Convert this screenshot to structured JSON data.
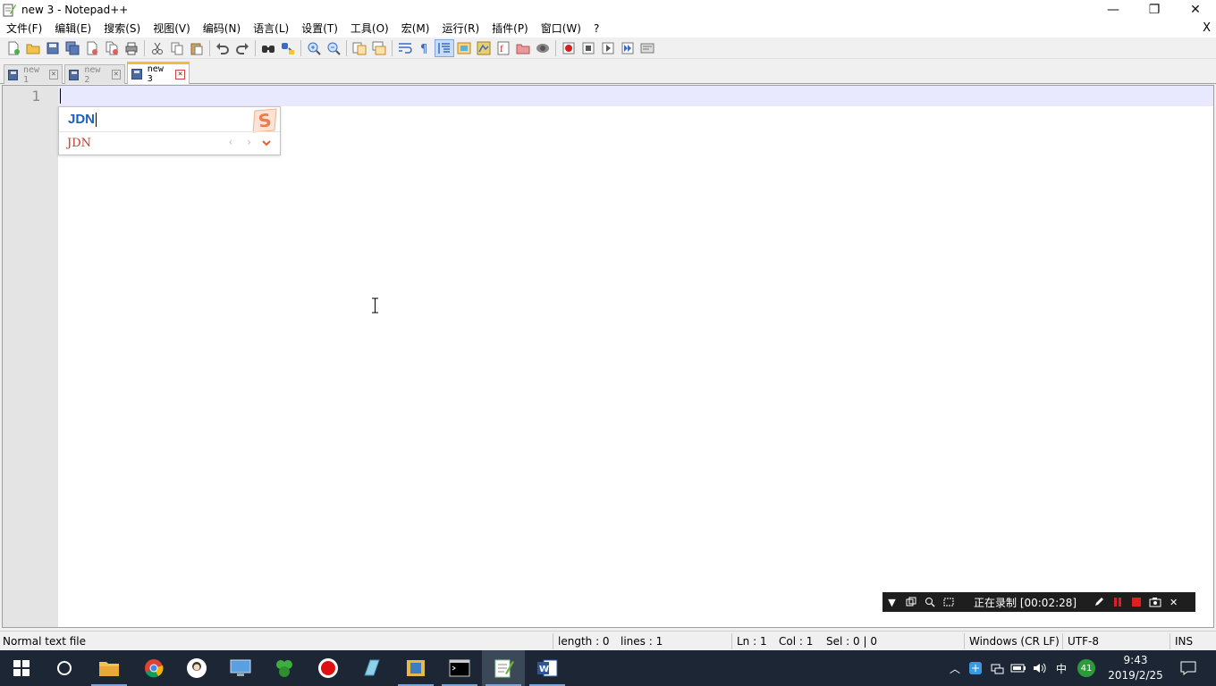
{
  "window": {
    "title": "new 3 - Notepad++",
    "minimize": "—",
    "maximize": "❐",
    "close": "✕"
  },
  "menu": {
    "items": [
      "文件(F)",
      "编辑(E)",
      "搜索(S)",
      "视图(V)",
      "编码(N)",
      "语言(L)",
      "设置(T)",
      "工具(O)",
      "宏(M)",
      "运行(R)",
      "插件(P)",
      "窗口(W)",
      "?"
    ],
    "close": "X"
  },
  "toolbar": {
    "buttons": [
      "new-file",
      "open-file",
      "save",
      "save-all",
      "close",
      "close-all",
      "print",
      "cut",
      "copy",
      "paste",
      "undo",
      "redo",
      "find",
      "replace",
      "zoom-in",
      "zoom-out",
      "sync-vertical",
      "sync-horizontal",
      "word-wrap",
      "show-all-chars",
      "indent-guide",
      "user-defined-language",
      "doc-map",
      "function-list",
      "folder-as-workspace",
      "monitoring",
      "record-macro",
      "stop-record",
      "play-macro",
      "run-macro-multiple",
      "save-macro"
    ]
  },
  "tabs": [
    {
      "label": "new 1",
      "active": false
    },
    {
      "label": "new 2",
      "active": false
    },
    {
      "label": "new 3",
      "active": true
    }
  ],
  "editor": {
    "line_numbers": [
      "1"
    ],
    "colors": {
      "gutter": "#e4e4e4",
      "current_line": "#e8e8ff"
    }
  },
  "ime": {
    "composition": "JDN",
    "candidate": "JDN",
    "nav": "‹ ›"
  },
  "recorder": {
    "status": "正在录制 [00:02:28]"
  },
  "status": {
    "file_type": "Normal text file",
    "length": "length : 0",
    "lines": "lines : 1",
    "ln": "Ln : 1",
    "col": "Col : 1",
    "sel": "Sel : 0 | 0",
    "eol": "Windows (CR LF)",
    "encoding": "UTF-8",
    "mode": "INS"
  },
  "taskbar": {
    "apps": [
      "start",
      "search",
      "file-explorer",
      "chrome",
      "avatar-app",
      "remote-desktop",
      "green-app",
      "recorder-app",
      "writer-app",
      "frame-app",
      "terminal",
      "notepadpp",
      "word"
    ],
    "tray": {
      "ime": "中",
      "badge": "41"
    },
    "time": "9:43",
    "date": "2019/2/25"
  }
}
